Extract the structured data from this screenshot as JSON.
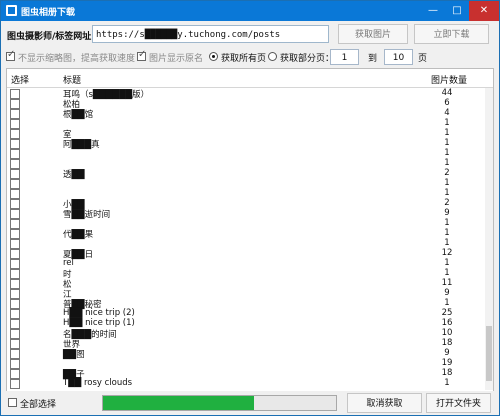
{
  "window": {
    "title": "图虫相册下载"
  },
  "toolbar": {
    "url_label": "图虫摄影师/标签网址：",
    "url_value": "https://s██████y.tuchong.com/posts",
    "fetch_button": "获取图片",
    "download_button": "立即下载",
    "option_no_thumbs": "不显示缩略图，提高获取速度",
    "option_show_original_name": "图片显示原名",
    "radio_all_pages": "获取所有页",
    "radio_some_pages": "获取部分页：",
    "page_from": "1",
    "page_to_label": "到",
    "page_to": "10",
    "page_unit": "页"
  },
  "table": {
    "col_select": "选择",
    "col_title": "标题",
    "col_count": "图片数量",
    "rows": [
      {
        "title": "耳鸣（s██████版）",
        "count": "44"
      },
      {
        "title": "松柏",
        "count": "6"
      },
      {
        "title": "根██馆",
        "count": "4"
      },
      {
        "title": "",
        "count": "1"
      },
      {
        "title": "室",
        "count": "1"
      },
      {
        "title": "阿███真",
        "count": "1"
      },
      {
        "title": "",
        "count": "1"
      },
      {
        "title": "",
        "count": "1"
      },
      {
        "title": "透██",
        "count": "2"
      },
      {
        "title": "",
        "count": "1"
      },
      {
        "title": "",
        "count": "1"
      },
      {
        "title": "小██",
        "count": "2"
      },
      {
        "title": "雪██逝时间",
        "count": "9"
      },
      {
        "title": "",
        "count": "1"
      },
      {
        "title": "代██果",
        "count": "1"
      },
      {
        "title": "",
        "count": "1"
      },
      {
        "title": "夏██日",
        "count": "12"
      },
      {
        "title": "rel",
        "count": "1"
      },
      {
        "title": "时",
        "count": "1"
      },
      {
        "title": "松",
        "count": "11"
      },
      {
        "title": "江",
        "count": "9"
      },
      {
        "title": "普██秘密",
        "count": "1"
      },
      {
        "title": "H██ nice trip (2)",
        "count": "25"
      },
      {
        "title": "H██ nice trip (1)",
        "count": "16"
      },
      {
        "title": "名███的时间",
        "count": "10"
      },
      {
        "title": "世界",
        "count": "18"
      },
      {
        "title": "██图",
        "count": "9"
      },
      {
        "title": "",
        "count": "19"
      },
      {
        "title": "██子",
        "count": "18"
      },
      {
        "title": "T██ rosy clouds",
        "count": "1"
      }
    ]
  },
  "bottom": {
    "select_all": "全部选择",
    "progress_percent": 65,
    "cancel_button": "取消获取",
    "open_folder_button": "打开文件夹"
  },
  "colors": {
    "title_bar": "#0a78d7",
    "progress": "#20b040",
    "close_button": "#c8302f"
  }
}
